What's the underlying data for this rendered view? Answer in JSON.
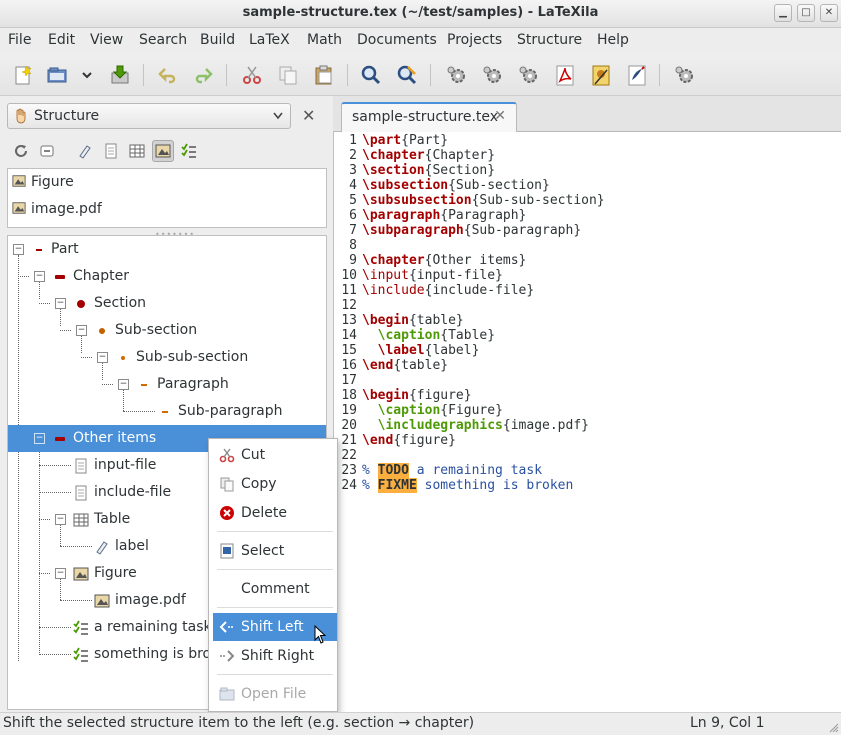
{
  "window": {
    "title": "sample-structure.tex (~/test/samples) - LaTeXila",
    "controls": [
      "minimize",
      "maximize",
      "close"
    ]
  },
  "menubar": {
    "items": [
      "File",
      "Edit",
      "View",
      "Search",
      "Build",
      "LaTeX",
      "Math",
      "Documents",
      "Projects",
      "Structure",
      "Help"
    ]
  },
  "toolbar": {
    "buttons": [
      "new-document-icon",
      "open-icon",
      "open-dropdown-icon",
      "save-icon",
      "undo-icon",
      "redo-icon",
      "cut-icon",
      "copy-icon",
      "paste-icon",
      "find-icon",
      "find-replace-icon",
      "build-icon",
      "build-icon",
      "build-icon",
      "view-pdf-icon",
      "view-dvi-icon",
      "view-ps-icon",
      "build-settings-icon"
    ]
  },
  "side_panel": {
    "selector_label": "Structure",
    "top_list": [
      "Figure",
      "image.pdf"
    ]
  },
  "tree": {
    "items": [
      {
        "label": "Part"
      },
      {
        "label": "Chapter"
      },
      {
        "label": "Section"
      },
      {
        "label": "Sub-section"
      },
      {
        "label": "Sub-sub-section"
      },
      {
        "label": "Paragraph"
      },
      {
        "label": "Sub-paragraph"
      },
      {
        "label": "Other items"
      },
      {
        "label": "input-file"
      },
      {
        "label": "include-file"
      },
      {
        "label": "Table"
      },
      {
        "label": "label"
      },
      {
        "label": "Figure"
      },
      {
        "label": "image.pdf"
      },
      {
        "label": "a remaining task"
      },
      {
        "label": "something is broken"
      }
    ]
  },
  "editor": {
    "tab_label": "sample-structure.tex",
    "lines": [
      {
        "n": "1",
        "text": "\\part{Part}"
      },
      {
        "n": "2",
        "text": "\\chapter{Chapter}"
      },
      {
        "n": "3",
        "text": "\\section{Section}"
      },
      {
        "n": "4",
        "text": "\\subsection{Sub-section}"
      },
      {
        "n": "5",
        "text": "\\subsubsection{Sub-sub-section}"
      },
      {
        "n": "6",
        "text": "\\paragraph{Paragraph}"
      },
      {
        "n": "7",
        "text": "\\subparagraph{Sub-paragraph}"
      },
      {
        "n": "8",
        "text": ""
      },
      {
        "n": "9",
        "text": "\\chapter{Other items}"
      },
      {
        "n": "10",
        "text": "\\input{input-file}"
      },
      {
        "n": "11",
        "text": "\\include{include-file}"
      },
      {
        "n": "12",
        "text": ""
      },
      {
        "n": "13",
        "text": "\\begin{table}"
      },
      {
        "n": "14",
        "text": "  \\caption{Table}"
      },
      {
        "n": "15",
        "text": "  \\label{label}"
      },
      {
        "n": "16",
        "text": "\\end{table}"
      },
      {
        "n": "17",
        "text": ""
      },
      {
        "n": "18",
        "text": "\\begin{figure}"
      },
      {
        "n": "19",
        "text": "  \\caption{Figure}"
      },
      {
        "n": "20",
        "text": "  \\includegraphics{image.pdf}"
      },
      {
        "n": "21",
        "text": "\\end{figure}"
      },
      {
        "n": "22",
        "text": ""
      },
      {
        "n": "23",
        "text": "% TODO a remaining task"
      },
      {
        "n": "24",
        "text": "% FIXME something is broken"
      }
    ]
  },
  "context_menu": {
    "items": [
      "Cut",
      "Copy",
      "Delete",
      "Select",
      "Comment",
      "Shift Left",
      "Shift Right",
      "Open File"
    ],
    "hovered": "Shift Left",
    "disabled": "Open File"
  },
  "statusbar": {
    "message": "Shift the selected structure item to the left (e.g. section → chapter)",
    "position": "Ln 9, Col 1"
  },
  "colors": {
    "selection": "#4a90d9",
    "latex_command": "#a40000",
    "caption_command": "#4e9a06",
    "comment": "#2a51a2",
    "todo_highlight": "#fcaf3e"
  }
}
